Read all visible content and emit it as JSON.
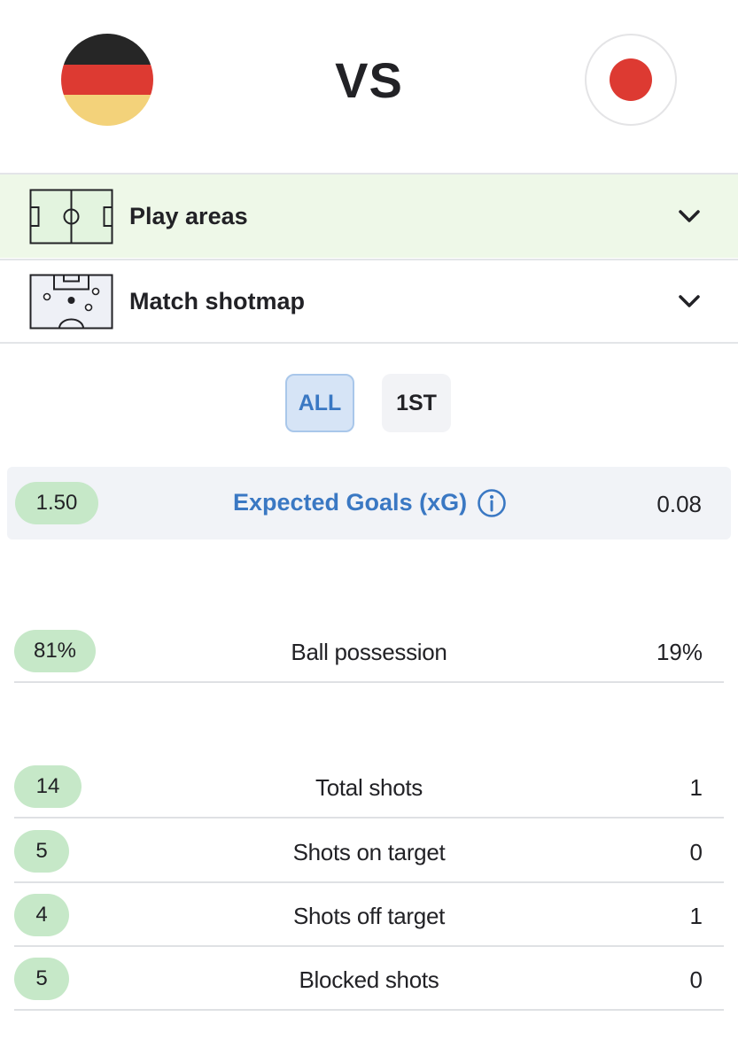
{
  "match": {
    "home_team_flag": "germany-flag",
    "away_team_flag": "japan-flag",
    "vs_label": "VS"
  },
  "sections": [
    {
      "title": "Play areas",
      "icon": "pitch-icon"
    },
    {
      "title": "Match shotmap",
      "icon": "shotmap-icon"
    }
  ],
  "period_tabs": {
    "all": "ALL",
    "first": "1ST",
    "selected": "ALL"
  },
  "xg": {
    "label": "Expected Goals (xG)",
    "home": "1.50",
    "away": "0.08"
  },
  "stats": [
    {
      "label": "Ball possession",
      "home": "81%",
      "away": "19%"
    },
    {
      "label": "Total shots",
      "home": "14",
      "away": "1"
    },
    {
      "label": "Shots on target",
      "home": "5",
      "away": "0"
    },
    {
      "label": "Shots off target",
      "home": "4",
      "away": "1"
    },
    {
      "label": "Blocked shots",
      "home": "5",
      "away": "0"
    }
  ],
  "colors": {
    "accent_blue": "#3a78c3",
    "home_highlight": "#c6e8c8",
    "play_areas_bg": "#eef8e8",
    "flag_red": "#dd3a32"
  }
}
